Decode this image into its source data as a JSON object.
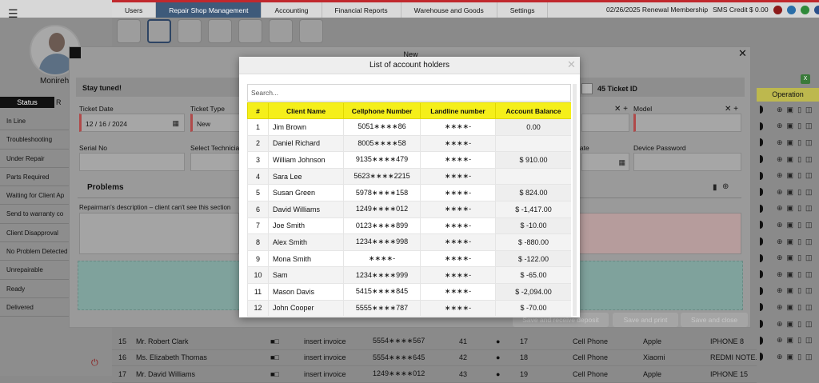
{
  "tabs": [
    {
      "label": "Users",
      "active": false
    },
    {
      "label": "Repair Shop Management",
      "active": true
    },
    {
      "label": "Accounting",
      "active": false
    },
    {
      "label": "Financial Reports",
      "active": false
    },
    {
      "label": "Warehouse and Goods",
      "active": false
    },
    {
      "label": "Settings",
      "active": false
    }
  ],
  "header_right": {
    "renewal": "02/26/2025 Renewal Membership",
    "sms_credit": "SMS Credit $ 0.00"
  },
  "colors": {
    "active_tab": "#3e5a7a",
    "table_header": "#f5ef1a",
    "top_accent": "#c0282d",
    "operation_header": "#bdb84e"
  },
  "user": {
    "name": "Monireh"
  },
  "status_panel": {
    "heading": "Status",
    "heading2": "R",
    "items": [
      "In Line",
      "Troubleshooting",
      "Under Repair",
      "Parts Required",
      "Waiting for Client Ap",
      "Send to warranty co",
      "Client Disapproval",
      "No Problem Detected",
      "Unrepairable",
      "Ready",
      "Delivered"
    ]
  },
  "operation_header": "Operation",
  "new_modal": {
    "title": "New",
    "notice": "Stay tuned!",
    "ticket_id_label": "45 Ticket ID",
    "ticket_date_label": "Ticket Date",
    "ticket_date_value": "12 / 16 / 2024",
    "ticket_type_label": "Ticket Type",
    "ticket_type_value": "New",
    "model_label": "Model",
    "serial_label": "Serial No",
    "technician_label": "Select Technicia",
    "date_label": "late",
    "device_password_label": "Device Password",
    "problems_label": "Problems",
    "repair_desc_label": "Repairman's description – client can't see this section",
    "btn_deposit": "Save and receive deposit",
    "btn_print": "Save and print",
    "btn_close": "Save and close"
  },
  "popup": {
    "title": "List of account holders",
    "search_placeholder": "Search...",
    "columns": [
      "#",
      "Client Name",
      "Cellphone Number",
      "Landline number",
      "Account Balance"
    ],
    "rows": [
      {
        "n": "1",
        "name": "Jim Brown",
        "cell": "5051∗∗∗∗86",
        "land": "∗∗∗∗-",
        "balance": "0.00"
      },
      {
        "n": "2",
        "name": "Daniel Richard",
        "cell": "8005∗∗∗∗58",
        "land": "∗∗∗∗-",
        "balance": ""
      },
      {
        "n": "3",
        "name": "William Johnson",
        "cell": "9135∗∗∗∗479",
        "land": "∗∗∗∗-",
        "balance": "$ 910.00"
      },
      {
        "n": "4",
        "name": "Sara Lee",
        "cell": "5623∗∗∗∗2215",
        "land": "∗∗∗∗-",
        "balance": ""
      },
      {
        "n": "5",
        "name": "Susan Green",
        "cell": "5978∗∗∗∗158",
        "land": "∗∗∗∗-",
        "balance": "$ 824.00"
      },
      {
        "n": "6",
        "name": "David Williams",
        "cell": "1249∗∗∗∗012",
        "land": "∗∗∗∗-",
        "balance": "$ -1,417.00"
      },
      {
        "n": "7",
        "name": "Joe Smith",
        "cell": "0123∗∗∗∗899",
        "land": "∗∗∗∗-",
        "balance": "$ -10.00"
      },
      {
        "n": "8",
        "name": "Alex Smith",
        "cell": "1234∗∗∗∗998",
        "land": "∗∗∗∗-",
        "balance": "$ -880.00"
      },
      {
        "n": "9",
        "name": "Mona Smith",
        "cell": "∗∗∗∗-",
        "land": "∗∗∗∗-",
        "balance": "$ -122.00"
      },
      {
        "n": "10",
        "name": "Sam",
        "cell": "1234∗∗∗∗999",
        "land": "∗∗∗∗-",
        "balance": "$ -65.00"
      },
      {
        "n": "11",
        "name": "Mason Davis",
        "cell": "5415∗∗∗∗845",
        "land": "∗∗∗∗-",
        "balance": "$ -2,094.00"
      },
      {
        "n": "12",
        "name": "John Cooper",
        "cell": "5555∗∗∗∗787",
        "land": "∗∗∗∗-",
        "balance": "$ -70.00"
      }
    ]
  },
  "background_rows": [
    {
      "n": "15",
      "name": "Mr. Robert Clark",
      "action": "insert invoice",
      "phone": "5554∗∗∗∗567",
      "a": "41",
      "b": "17",
      "type": "Cell Phone",
      "brand": "Apple",
      "model": "IPHONE 8"
    },
    {
      "n": "16",
      "name": "Ms. Elizabeth Thomas",
      "action": "insert invoice",
      "phone": "5554∗∗∗∗645",
      "a": "42",
      "b": "18",
      "type": "Cell Phone",
      "brand": "Xiaomi",
      "model": "REDMI NOTE..."
    },
    {
      "n": "17",
      "name": "Mr. David Williams",
      "action": "insert invoice",
      "phone": "1249∗∗∗∗012",
      "a": "43",
      "b": "19",
      "type": "Cell Phone",
      "brand": "Apple",
      "model": "IPHONE 15"
    }
  ]
}
